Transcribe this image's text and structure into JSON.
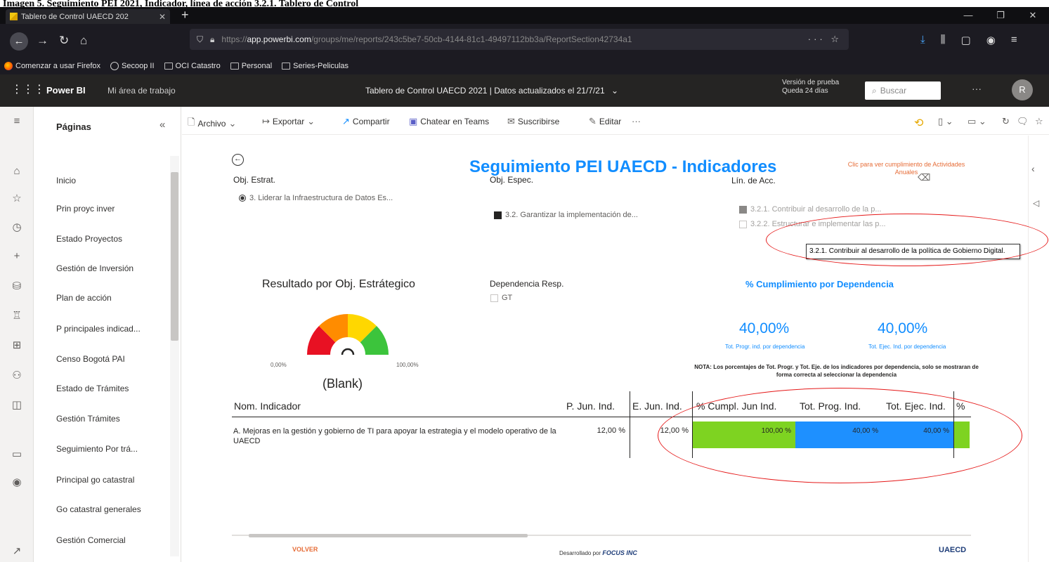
{
  "caption": "Imagen 5. Seguimiento PEI 2021, Indicador, línea de acción 3.2.1. Tablero de Control",
  "browser": {
    "tab_title": "Tablero de Control UAECD 202",
    "url_prefix": "https://",
    "url_domain": "app.powerbi.com",
    "url_rest": "/groups/me/reports/243c5be7-50cb-4144-81c1-49497112bb3a/ReportSection42734a1",
    "bookmarks": [
      "Comenzar a usar Firefox",
      "Secoop II",
      "OCI Catastro",
      "Personal",
      "Series-Peliculas"
    ]
  },
  "pbi": {
    "brand": "Power BI",
    "workspace": "Mi área de trabajo",
    "report_title": "Tablero de Control UAECD 2021  |  Datos actualizados el 21/7/21",
    "trial_line1": "Versión de prueba",
    "trial_line2": "Queda 24 días",
    "search_placeholder": "Buscar",
    "avatar_initial": "R"
  },
  "pages_pane": {
    "title": "Páginas",
    "items": [
      "Inicio",
      "Prin proyc inver",
      "Estado Proyectos",
      "Gestión de Inversión",
      "Plan de acción",
      "P principales indicad...",
      "Censo Bogotá PAI",
      "Estado de Trámites",
      "Gestión Trámites",
      "Seguimiento Por trá...",
      "Principal go catastral",
      "Go catastral generales",
      "Gestión Comercial"
    ]
  },
  "toolbar": {
    "archivo": "Archivo",
    "exportar": "Exportar",
    "compartir": "Compartir",
    "chatear": "Chatear en Teams",
    "suscribirse": "Suscribirse",
    "editar": "Editar"
  },
  "report": {
    "heading": "Seguimiento PEI UAECD - Indicadores",
    "link_actividades": "Clic para ver cumplimiento de Actividades Anuales",
    "obj_estrat_title": "Obj. Estrat.",
    "obj_estrat_value": "3. Liderar la Infraestructura de Datos Es...",
    "obj_espec_title": "Obj. Espec.",
    "obj_espec_value": "3.2. Garantizar la implementación de...",
    "lin_acc_title": "Lín. de Acc.",
    "lin_acc_value1": "3.2.1. Contribuir al desarrollo de la p...",
    "lin_acc_value2": "3.2.2. Estructurar e implementar las p...",
    "tooltip": "3.2.1. Contribuir al desarrollo de la política de Gobierno Digital.",
    "gauge_title": "Resultado por Obj. Estrátegico",
    "gauge_min": "0,00%",
    "gauge_max": "100,00%",
    "gauge_value": "(Blank)",
    "dependencia_title": "Dependencia Resp.",
    "dependencia_value": "GT",
    "kpi_title": "% Cumplimiento por Dependencia",
    "kpi1_value": "40,00%",
    "kpi1_label": "Tot. Progr. ind. por dependencia",
    "kpi2_value": "40,00%",
    "kpi2_label": "Tot. Ejec. Ind. por dependencia",
    "note": "NOTA: Los porcentajes de Tot. Progr. y Tot. Eje. de los indicadores por dependencia, solo se mostraran de forma correcta al seleccionar la dependencia",
    "footer_volver": "VOLVER",
    "footer_focus_prefix": "Desarrollado por",
    "footer_focus": "FOCUS INC",
    "footer_uaecd": "UAECD"
  },
  "table": {
    "headers": [
      "Nom. Indicador",
      "P. Jun. Ind.",
      "E. Jun. Ind.",
      "% Cumpl. Jun Ind.",
      "Tot. Prog. Ind.",
      "Tot. Ejec. Ind.",
      "%"
    ],
    "row": {
      "indicador": "A. Mejoras en la gestión y gobierno de TI para apoyar la estrategia y el modelo operativo de la UAECD",
      "p_jun": "12,00 %",
      "e_jun": "12,00 %",
      "cumpl": "100,00 %",
      "tot_prog": "40,00 %",
      "tot_ejec": "40,00 %"
    }
  },
  "colors": {
    "accent_blue": "#118dff",
    "cell_green": "#7ed321",
    "cell_blue": "#1e90ff",
    "orange": "#e66c37",
    "highlight_red": "#e51a1a"
  },
  "gauge": {
    "min": 0,
    "max": 100,
    "value": null,
    "bands": [
      {
        "color": "#e81123",
        "from": 0,
        "to": 25
      },
      {
        "color": "#ff8c00",
        "from": 25,
        "to": 50
      },
      {
        "color": "#ffd700",
        "from": 50,
        "to": 75
      },
      {
        "color": "#3cc43c",
        "from": 75,
        "to": 100
      }
    ]
  }
}
